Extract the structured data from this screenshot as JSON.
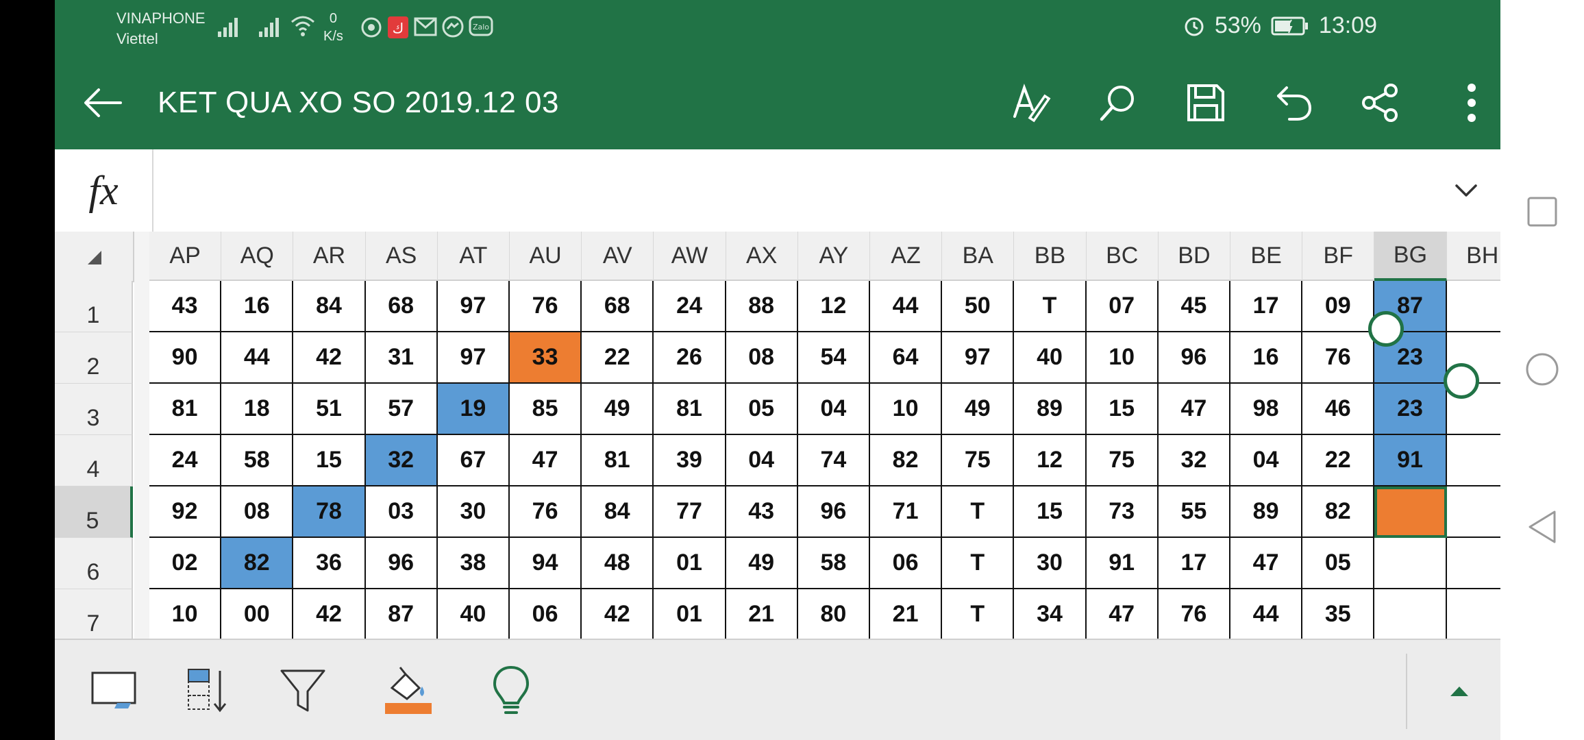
{
  "status": {
    "carrier1": "VINAPHONE",
    "carrier2": "Viettel",
    "speed_value": "0",
    "speed_unit": "K/s",
    "battery": "53%",
    "time": "13:09"
  },
  "appbar": {
    "title": "KET QUA XO SO 2019.12 03"
  },
  "formula": {
    "fx_label": "fx",
    "value": ""
  },
  "columns": [
    "AP",
    "AQ",
    "AR",
    "AS",
    "AT",
    "AU",
    "AV",
    "AW",
    "AX",
    "AY",
    "AZ",
    "BA",
    "BB",
    "BC",
    "BD",
    "BE",
    "BF",
    "BG",
    "BH"
  ],
  "selected_column": "BG",
  "rows": [
    {
      "label": "1",
      "cells": [
        "43",
        "16",
        "84",
        "68",
        "97",
        "76",
        "68",
        "24",
        "88",
        "12",
        "44",
        "50",
        "T",
        "07",
        "45",
        "17",
        "09",
        "87",
        ""
      ]
    },
    {
      "label": "2",
      "cells": [
        "90",
        "44",
        "42",
        "31",
        "97",
        "33",
        "22",
        "26",
        "08",
        "54",
        "64",
        "97",
        "40",
        "10",
        "96",
        "16",
        "76",
        "23",
        ""
      ]
    },
    {
      "label": "3",
      "cells": [
        "81",
        "18",
        "51",
        "57",
        "19",
        "85",
        "49",
        "81",
        "05",
        "04",
        "10",
        "49",
        "89",
        "15",
        "47",
        "98",
        "46",
        "23",
        ""
      ]
    },
    {
      "label": "4",
      "cells": [
        "24",
        "58",
        "15",
        "32",
        "67",
        "47",
        "81",
        "39",
        "04",
        "74",
        "82",
        "75",
        "12",
        "75",
        "32",
        "04",
        "22",
        "91",
        ""
      ]
    },
    {
      "label": "5",
      "cells": [
        "92",
        "08",
        "78",
        "03",
        "30",
        "76",
        "84",
        "77",
        "43",
        "96",
        "71",
        "T",
        "15",
        "73",
        "55",
        "89",
        "82",
        "",
        ""
      ]
    },
    {
      "label": "6",
      "cells": [
        "02",
        "82",
        "36",
        "96",
        "38",
        "94",
        "48",
        "01",
        "49",
        "58",
        "06",
        "T",
        "30",
        "91",
        "17",
        "47",
        "05",
        "",
        ""
      ]
    },
    {
      "label": "7",
      "cells": [
        "10",
        "00",
        "42",
        "87",
        "40",
        "06",
        "42",
        "01",
        "21",
        "80",
        "21",
        "T",
        "34",
        "47",
        "76",
        "44",
        "35",
        "",
        ""
      ]
    }
  ],
  "selected_row": "5",
  "colors": {
    "brand_green": "#217346",
    "highlight_blue": "#5b9bd5",
    "highlight_orange": "#ed7d31"
  }
}
